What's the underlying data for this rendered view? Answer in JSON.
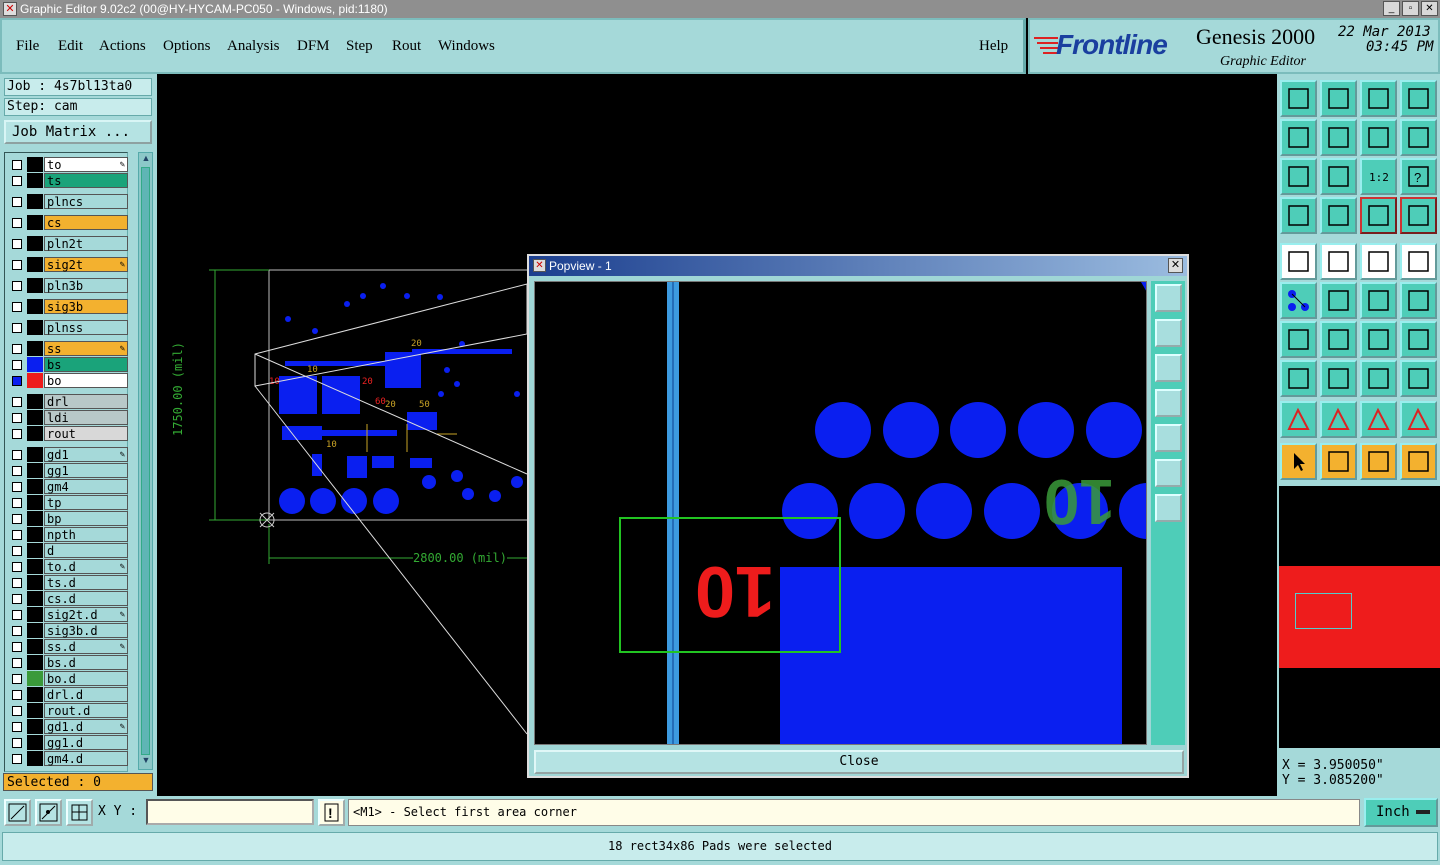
{
  "window": {
    "title": "Graphic Editor 9.02c2 (00@HY-HYCAM-PC050 - Windows, pid:1180)"
  },
  "menu": [
    "File",
    "Edit",
    "Actions",
    "Options",
    "Analysis",
    "DFM",
    "Step",
    "Rout",
    "Windows"
  ],
  "help": "Help",
  "brand": {
    "logo": "Frontline",
    "product": "Genesis 2000",
    "subtitle": "Graphic Editor",
    "date": "22 Mar 2013",
    "time": "03:45 PM"
  },
  "job": {
    "job": "Job : 4s7bl13ta0",
    "step": "Step: cam",
    "matrix_button": "Job Matrix ..."
  },
  "layers": [
    {
      "name": "to",
      "color": "#ffffff",
      "edit": true
    },
    {
      "name": "ts",
      "color": "#1aa37a"
    },
    {
      "name": "plncs",
      "color": "#a5d9d9"
    },
    {
      "name": "cs",
      "color": "#f3b12f"
    },
    {
      "name": "pln2t",
      "color": "#a5d9d9"
    },
    {
      "name": "sig2t",
      "color": "#f3b12f",
      "edit": true
    },
    {
      "name": "pln3b",
      "color": "#a5d9d9"
    },
    {
      "name": "sig3b",
      "color": "#f3b12f"
    },
    {
      "name": "plnss",
      "color": "#a5d9d9"
    },
    {
      "name": "ss",
      "color": "#f3b12f",
      "edit": true
    },
    {
      "name": "bs",
      "color": "#1aa37a"
    },
    {
      "name": "bo",
      "color": "#ffffff"
    },
    {
      "name": "drl",
      "color": "#b8c8c8"
    },
    {
      "name": "ldi",
      "color": "#b8c8c8"
    },
    {
      "name": "rout",
      "color": "#d8d8d8"
    },
    {
      "name": "gd1",
      "color": "#a5d9d9",
      "edit": true
    },
    {
      "name": "gg1",
      "color": "#a5d9d9"
    },
    {
      "name": "gm4",
      "color": "#a5d9d9"
    },
    {
      "name": "tp",
      "color": "#a5d9d9"
    },
    {
      "name": "bp",
      "color": "#a5d9d9"
    },
    {
      "name": "npth",
      "color": "#a5d9d9"
    },
    {
      "name": "d",
      "color": "#a5d9d9"
    },
    {
      "name": "to.d",
      "color": "#a5d9d9",
      "edit": true
    },
    {
      "name": "ts.d",
      "color": "#a5d9d9"
    },
    {
      "name": "cs.d",
      "color": "#a5d9d9"
    },
    {
      "name": "sig2t.d",
      "color": "#a5d9d9",
      "edit": true
    },
    {
      "name": "sig3b.d",
      "color": "#a5d9d9"
    },
    {
      "name": "ss.d",
      "color": "#a5d9d9",
      "edit": true
    },
    {
      "name": "bs.d",
      "color": "#a5d9d9"
    },
    {
      "name": "bo.d",
      "color": "#a5d9d9"
    },
    {
      "name": "drl.d",
      "color": "#a5d9d9"
    },
    {
      "name": "rout.d",
      "color": "#a5d9d9"
    },
    {
      "name": "gd1.d",
      "color": "#a5d9d9",
      "edit": true
    },
    {
      "name": "gg1.d",
      "color": "#a5d9d9"
    },
    {
      "name": "gm4.d",
      "color": "#a5d9d9"
    }
  ],
  "selected": "Selected : 0",
  "dims": {
    "width": "2800.00 (mil)",
    "height": "1750.00 (mil)"
  },
  "popview": {
    "title": "Popview - 1",
    "close": "Close",
    "label": "10"
  },
  "coords": {
    "x": "X = 3.950050\"",
    "y": "Y = 3.085200\""
  },
  "xy_label": "X Y :",
  "prompt": "<M1> - Select first area corner",
  "units": "Inch",
  "status": "18 rect34x86 Pads were selected",
  "toolbar_ratio": "1:2"
}
